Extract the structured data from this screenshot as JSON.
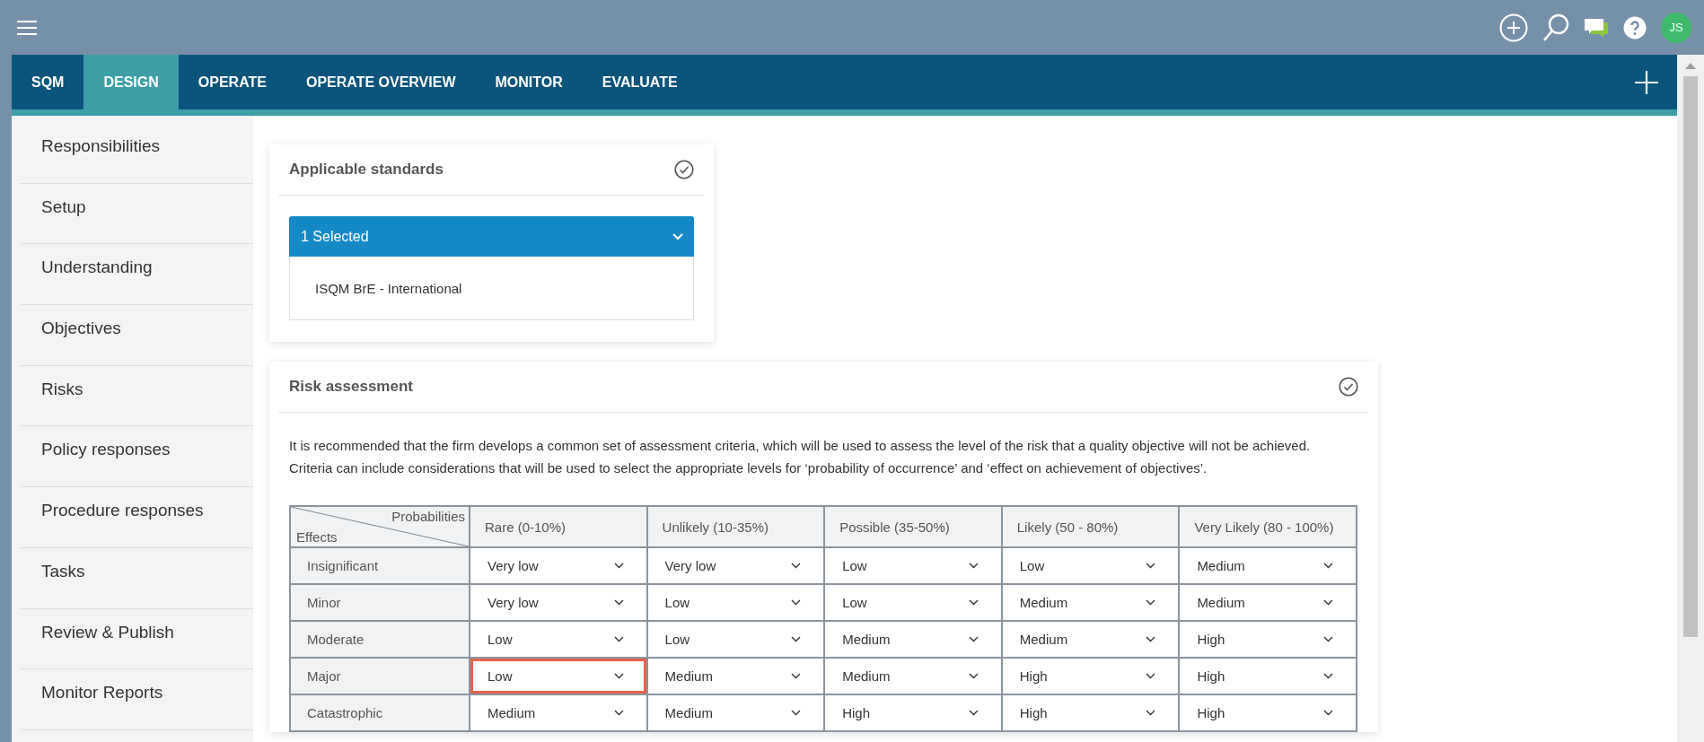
{
  "top_bar": {
    "avatar_initials": "JS"
  },
  "tabs": [
    {
      "label": "SQM",
      "selected": false
    },
    {
      "label": "DESIGN",
      "selected": true
    },
    {
      "label": "OPERATE",
      "selected": false
    },
    {
      "label": "OPERATE OVERVIEW",
      "selected": false
    },
    {
      "label": "MONITOR",
      "selected": false
    },
    {
      "label": "EVALUATE",
      "selected": false
    }
  ],
  "sidebar": {
    "items": [
      "Responsibilities",
      "Setup",
      "Understanding",
      "Objectives",
      "Risks",
      "Policy responses",
      "Procedure responses",
      "Tasks",
      "Review & Publish",
      "Monitor Reports"
    ]
  },
  "applicable_standards": {
    "title": "Applicable standards",
    "dropdown": {
      "value": "1 Selected",
      "options": [
        "ISQM BrE - International"
      ]
    }
  },
  "risk_assessment": {
    "title": "Risk assessment",
    "description": [
      "It is recommended that the firm develops a common set of assessment criteria, which will be used to assess the level of the risk that a quality objective will not be achieved.",
      "Criteria can include considerations that will be used to select the appropriate levels for ‘probability of occurrence’ and ‘effect on achievement of objectives’."
    ],
    "table": {
      "corner": {
        "top": "Probabilities",
        "bottom": "Effects"
      },
      "columns": [
        "Rare (0-10%)",
        "Unlikely (10-35%)",
        "Possible (35-50%)",
        "Likely (50 - 80%)",
        "Very Likely (80 - 100%)"
      ],
      "rows": [
        {
          "label": "Insignificant",
          "cells": [
            {
              "value": "Very low",
              "highlighted": false
            },
            {
              "value": "Very low",
              "highlighted": false
            },
            {
              "value": "Low",
              "highlighted": false
            },
            {
              "value": "Low",
              "highlighted": false
            },
            {
              "value": "Medium",
              "highlighted": false
            }
          ]
        },
        {
          "label": "Minor",
          "cells": [
            {
              "value": "Very low",
              "highlighted": false
            },
            {
              "value": "Low",
              "highlighted": false
            },
            {
              "value": "Low",
              "highlighted": false
            },
            {
              "value": "Medium",
              "highlighted": false
            },
            {
              "value": "Medium",
              "highlighted": false
            }
          ]
        },
        {
          "label": "Moderate",
          "cells": [
            {
              "value": "Low",
              "highlighted": false
            },
            {
              "value": "Low",
              "highlighted": false
            },
            {
              "value": "Medium",
              "highlighted": false
            },
            {
              "value": "Medium",
              "highlighted": false
            },
            {
              "value": "High",
              "highlighted": false
            }
          ]
        },
        {
          "label": "Major",
          "cells": [
            {
              "value": "Low",
              "highlighted": true
            },
            {
              "value": "Medium",
              "highlighted": false
            },
            {
              "value": "Medium",
              "highlighted": false
            },
            {
              "value": "High",
              "highlighted": false
            },
            {
              "value": "High",
              "highlighted": false
            }
          ]
        },
        {
          "label": "Catastrophic",
          "cells": [
            {
              "value": "Medium",
              "highlighted": false
            },
            {
              "value": "Medium",
              "highlighted": false
            },
            {
              "value": "High",
              "highlighted": false
            },
            {
              "value": "High",
              "highlighted": false
            },
            {
              "value": "High",
              "highlighted": false
            }
          ]
        }
      ]
    }
  }
}
